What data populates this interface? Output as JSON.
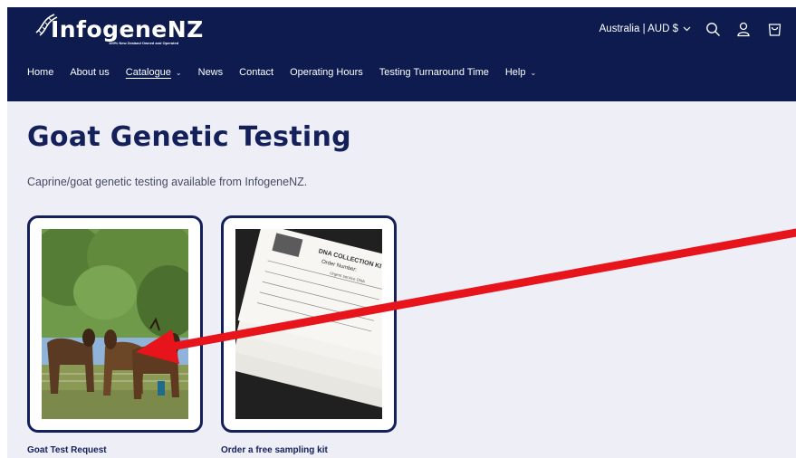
{
  "brand": {
    "name": "InfogeneNZ",
    "tagline": "100% New Zealand Owned and Operated"
  },
  "header": {
    "currency": "Australia | AUD $",
    "icons": [
      "search-icon",
      "account-icon",
      "cart-icon"
    ]
  },
  "nav": {
    "items": [
      {
        "label": "Home",
        "dropdown": false
      },
      {
        "label": "About us",
        "dropdown": false
      },
      {
        "label": "Catalogue",
        "dropdown": true,
        "active": true
      },
      {
        "label": "News",
        "dropdown": false
      },
      {
        "label": "Contact",
        "dropdown": false
      },
      {
        "label": "Operating Hours",
        "dropdown": false
      },
      {
        "label": "Testing Turnaround Time",
        "dropdown": false
      },
      {
        "label": "Help",
        "dropdown": true
      }
    ]
  },
  "page": {
    "title": "Goat Genetic Testing",
    "description": "Caprine/goat genetic testing available from InfogeneNZ."
  },
  "products": [
    {
      "title": "Goat Test Request"
    },
    {
      "title": "Order a free sampling kit"
    }
  ],
  "kit_image_text": {
    "heading": "DNA COLLECTION KIT",
    "order": "Order Number:",
    "urgent": "Urgent service DNA"
  },
  "colors": {
    "navy": "#0d1b4f",
    "title": "#14205a",
    "background": "#eeeef6",
    "arrow": "#e8141b"
  }
}
